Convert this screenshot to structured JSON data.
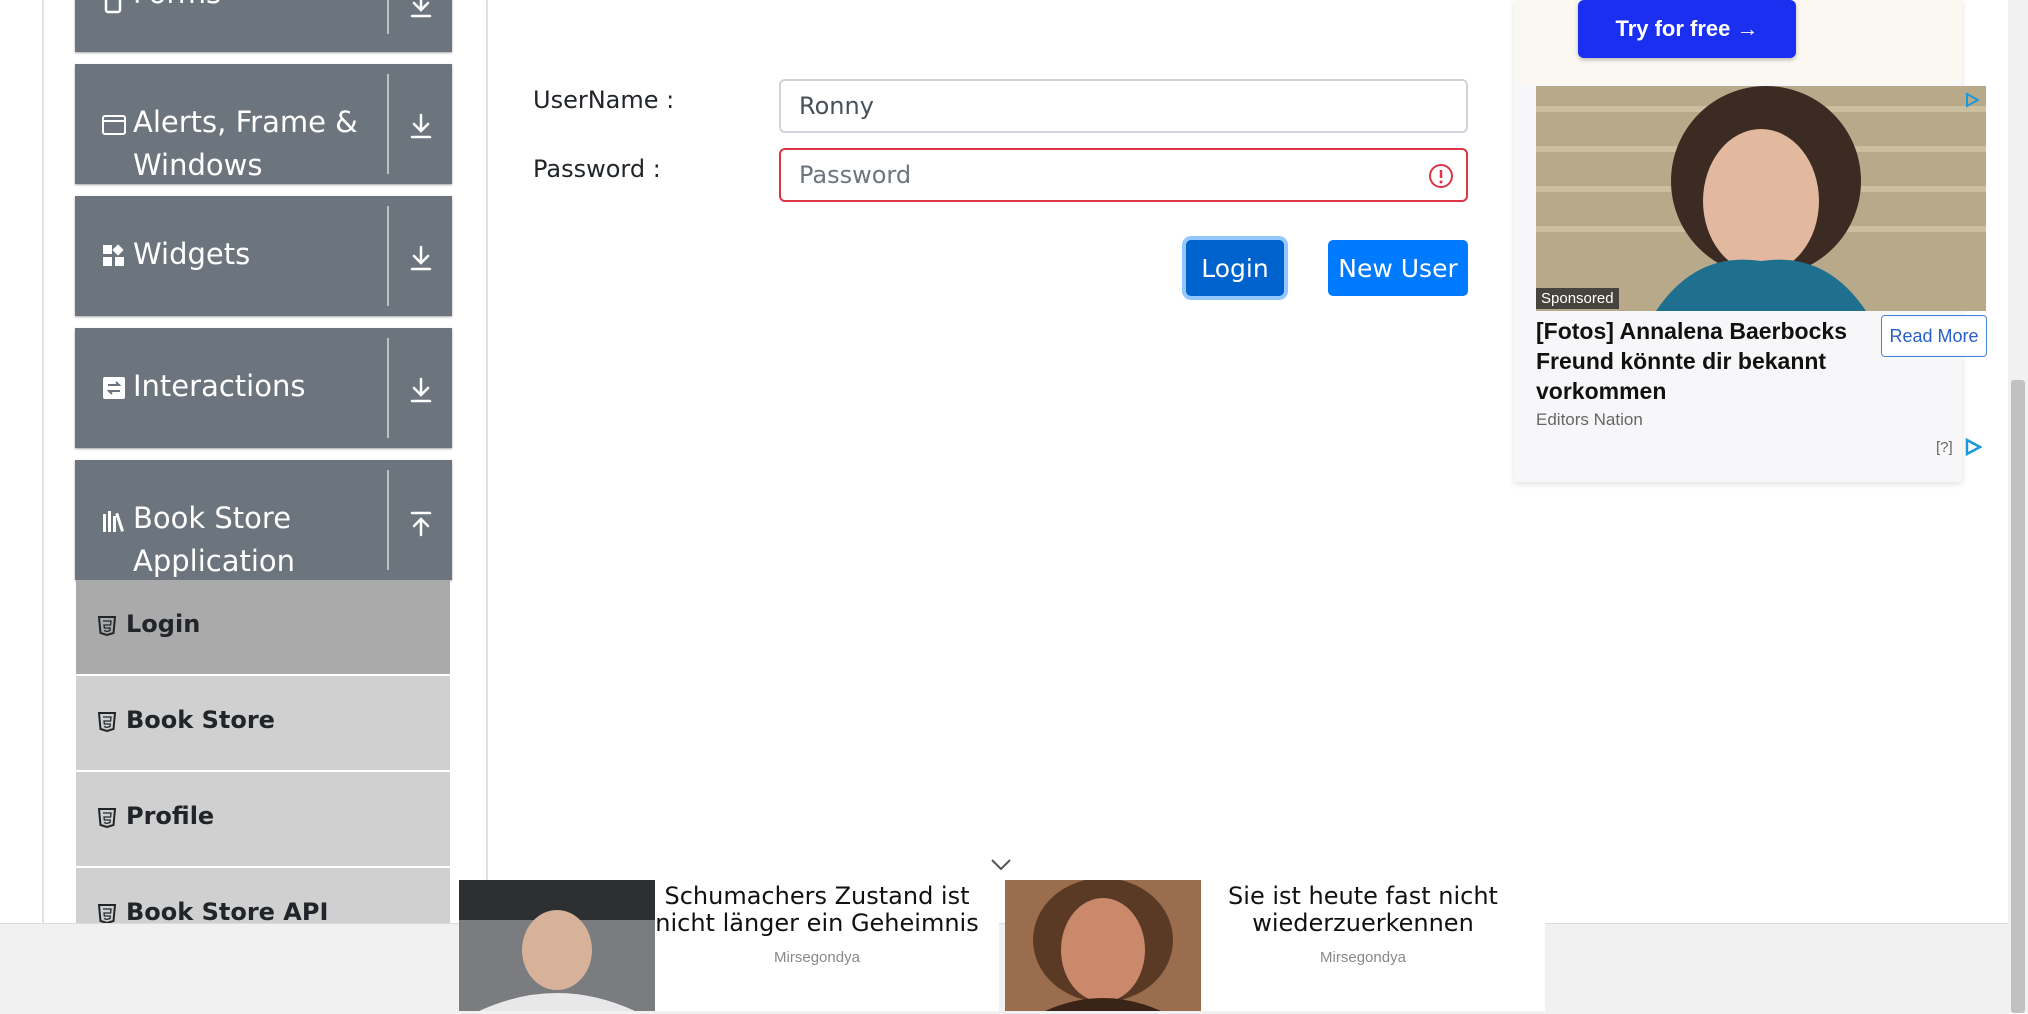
{
  "sidebar": {
    "groups": [
      {
        "label": "Forms"
      },
      {
        "label_line1": "Alerts, Frame &",
        "label_line2": "Windows"
      },
      {
        "label": "Widgets"
      },
      {
        "label": "Interactions"
      },
      {
        "label_line1": "Book Store",
        "label_line2": "Application"
      }
    ],
    "items": [
      {
        "label": "Login",
        "active": true
      },
      {
        "label": "Book Store"
      },
      {
        "label": "Profile"
      },
      {
        "label": "Book Store API"
      }
    ]
  },
  "form": {
    "username_label": "UserName :",
    "username_value": "Ronny",
    "password_label": "Password :",
    "password_placeholder": "Password",
    "login_button": "Login",
    "new_user_button": "New User"
  },
  "ad": {
    "try_button": "Try for free →",
    "sponsored": "Sponsored",
    "headline": "[Fotos] Annalena Baerbocks Freund könnte dir bekannt vorkommen",
    "read_more": "Read More",
    "source": "Editors Nation",
    "help": "[?]"
  },
  "bottom_ads": [
    {
      "title": "Schumachers Zustand ist nicht länger ein Geheimnis",
      "source": "Mirsegondya"
    },
    {
      "title": "Sie ist heute fast nicht wiederzuerkennen",
      "source": "Mirsegondya"
    }
  ],
  "colors": {
    "primary": "#007bff",
    "sidebar_group": "#6c757d",
    "invalid": "#dc3545",
    "try_button": "#1a2ff0"
  }
}
